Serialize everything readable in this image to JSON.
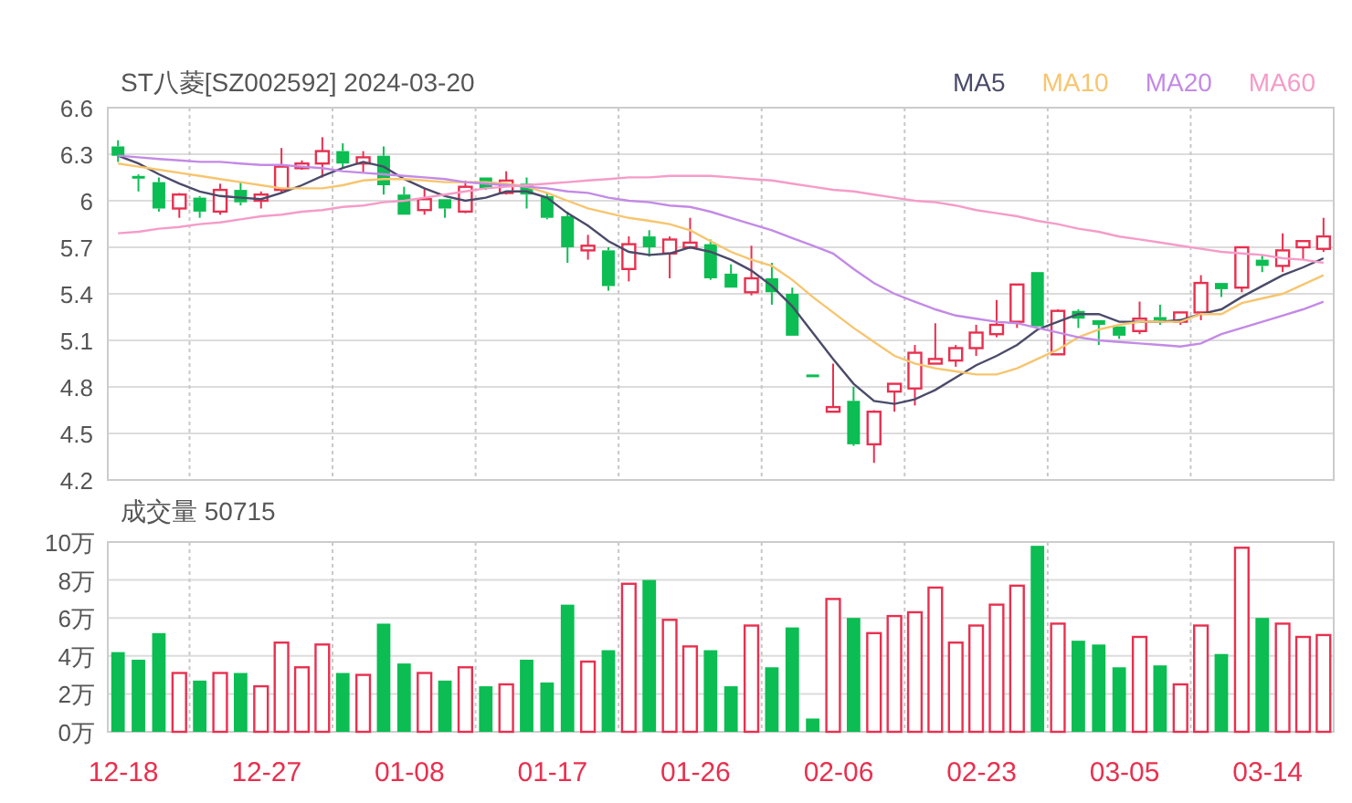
{
  "price_chart": {
    "title": "ST八菱[SZ002592] 2024-03-20",
    "chart_data": {
      "type": "candlestick",
      "grid": true,
      "ylim": [
        4.2,
        6.6
      ],
      "yticks": [
        4.2,
        4.5,
        4.8,
        5.1,
        5.4,
        5.7,
        6,
        6.3,
        6.6
      ],
      "ohlc": [
        [
          6.35,
          6.39,
          6.25,
          6.29
        ],
        [
          6.16,
          6.17,
          6.06,
          6.15
        ],
        [
          6.12,
          6.15,
          5.93,
          5.95
        ],
        [
          5.95,
          6.05,
          5.89,
          6.04
        ],
        [
          6.02,
          6.03,
          5.89,
          5.93
        ],
        [
          5.93,
          6.11,
          5.91,
          6.07
        ],
        [
          6.07,
          6.12,
          5.97,
          5.99
        ],
        [
          6.0,
          6.06,
          5.95,
          6.04
        ],
        [
          6.07,
          6.34,
          6.05,
          6.22
        ],
        [
          6.21,
          6.26,
          6.2,
          6.24
        ],
        [
          6.24,
          6.41,
          6.15,
          6.32
        ],
        [
          6.32,
          6.37,
          6.21,
          6.24
        ],
        [
          6.24,
          6.32,
          6.18,
          6.28
        ],
        [
          6.29,
          6.35,
          6.04,
          6.1
        ],
        [
          6.04,
          6.09,
          5.91,
          5.91
        ],
        [
          5.94,
          6.08,
          5.91,
          6.01
        ],
        [
          6.01,
          6.01,
          5.89,
          5.95
        ],
        [
          5.93,
          6.13,
          5.92,
          6.09
        ],
        [
          6.15,
          6.15,
          6.07,
          6.08
        ],
        [
          6.05,
          6.19,
          6.04,
          6.13
        ],
        [
          6.11,
          6.15,
          5.95,
          6.04
        ],
        [
          6.03,
          6.05,
          5.88,
          5.89
        ],
        [
          5.9,
          5.93,
          5.6,
          5.7
        ],
        [
          5.68,
          5.78,
          5.62,
          5.71
        ],
        [
          5.68,
          5.7,
          5.42,
          5.45
        ],
        [
          5.56,
          5.77,
          5.48,
          5.72
        ],
        [
          5.77,
          5.81,
          5.64,
          5.7
        ],
        [
          5.66,
          5.77,
          5.5,
          5.75
        ],
        [
          5.7,
          5.89,
          5.69,
          5.73
        ],
        [
          5.72,
          5.75,
          5.49,
          5.5
        ],
        [
          5.53,
          5.59,
          5.44,
          5.44
        ],
        [
          5.41,
          5.71,
          5.39,
          5.5
        ],
        [
          5.5,
          5.6,
          5.33,
          5.41
        ],
        [
          5.4,
          5.44,
          5.13,
          5.13
        ],
        [
          4.88,
          4.88,
          4.87,
          4.87
        ],
        [
          4.64,
          4.95,
          4.64,
          4.67
        ],
        [
          4.71,
          4.8,
          4.42,
          4.43
        ],
        [
          4.43,
          4.65,
          4.31,
          4.64
        ],
        [
          4.77,
          4.82,
          4.64,
          4.82
        ],
        [
          4.79,
          5.07,
          4.68,
          5.02
        ],
        [
          4.95,
          5.21,
          4.95,
          4.98
        ],
        [
          4.97,
          5.07,
          4.93,
          5.05
        ],
        [
          5.05,
          5.2,
          5.0,
          5.15
        ],
        [
          5.14,
          5.36,
          5.12,
          5.2
        ],
        [
          5.22,
          5.46,
          5.18,
          5.46
        ],
        [
          5.54,
          5.54,
          5.19,
          5.19
        ],
        [
          5.01,
          5.3,
          5.01,
          5.29
        ],
        [
          5.29,
          5.3,
          5.18,
          5.24
        ],
        [
          5.23,
          5.23,
          5.07,
          5.2
        ],
        [
          5.19,
          5.19,
          5.11,
          5.13
        ],
        [
          5.16,
          5.35,
          5.14,
          5.24
        ],
        [
          5.25,
          5.33,
          5.2,
          5.23
        ],
        [
          5.22,
          5.28,
          5.2,
          5.28
        ],
        [
          5.28,
          5.52,
          5.23,
          5.47
        ],
        [
          5.47,
          5.47,
          5.38,
          5.43
        ],
        [
          5.44,
          5.7,
          5.41,
          5.7
        ],
        [
          5.62,
          5.65,
          5.54,
          5.58
        ],
        [
          5.58,
          5.79,
          5.54,
          5.68
        ],
        [
          5.7,
          5.74,
          5.62,
          5.74
        ],
        [
          5.69,
          5.89,
          5.67,
          5.77
        ]
      ]
    }
  },
  "moving_averages": {
    "chart_data": {
      "type": "line",
      "ylim": [
        4.2,
        6.6
      ],
      "series": [
        {
          "name": "MA5",
          "color": "#4a4a6a",
          "values": [
            6.29,
            6.24,
            6.17,
            6.11,
            6.06,
            6.03,
            6.02,
            6.01,
            6.05,
            6.1,
            6.16,
            6.21,
            6.25,
            6.22,
            6.14,
            6.08,
            6.03,
            6.0,
            6.02,
            6.06,
            6.06,
            6.02,
            5.92,
            5.84,
            5.74,
            5.67,
            5.65,
            5.66,
            5.7,
            5.67,
            5.62,
            5.55,
            5.45,
            5.32,
            5.15,
            4.98,
            4.82,
            4.71,
            4.69,
            4.72,
            4.78,
            4.86,
            4.94,
            5.0,
            5.07,
            5.17,
            5.22,
            5.27,
            5.27,
            5.22,
            5.22,
            5.22,
            5.23,
            5.27,
            5.3,
            5.38,
            5.45,
            5.52,
            5.57,
            5.63
          ]
        },
        {
          "name": "MA10",
          "color": "#f7c56e",
          "values": [
            6.24,
            6.22,
            6.2,
            6.18,
            6.16,
            6.14,
            6.12,
            6.1,
            6.08,
            6.08,
            6.08,
            6.1,
            6.13,
            6.14,
            6.14,
            6.13,
            6.12,
            6.12,
            6.12,
            6.11,
            6.09,
            6.05,
            6.0,
            5.95,
            5.92,
            5.89,
            5.87,
            5.85,
            5.81,
            5.74,
            5.67,
            5.62,
            5.58,
            5.49,
            5.38,
            5.28,
            5.18,
            5.09,
            5.0,
            4.95,
            4.92,
            4.9,
            4.88,
            4.88,
            4.92,
            4.98,
            5.04,
            5.12,
            5.17,
            5.2,
            5.22,
            5.22,
            5.22,
            5.27,
            5.27,
            5.34,
            5.37,
            5.4,
            5.46,
            5.52
          ]
        },
        {
          "name": "MA20",
          "color": "#c38ae6",
          "values": [
            6.29,
            6.28,
            6.27,
            6.26,
            6.25,
            6.25,
            6.24,
            6.23,
            6.23,
            6.22,
            6.21,
            6.19,
            6.18,
            6.17,
            6.16,
            6.15,
            6.14,
            6.12,
            6.11,
            6.1,
            6.09,
            6.08,
            6.06,
            6.05,
            6.02,
            6.0,
            5.99,
            5.97,
            5.96,
            5.93,
            5.89,
            5.85,
            5.81,
            5.76,
            5.71,
            5.66,
            5.56,
            5.47,
            5.4,
            5.35,
            5.3,
            5.26,
            5.24,
            5.22,
            5.21,
            5.18,
            5.15,
            5.12,
            5.1,
            5.09,
            5.08,
            5.07,
            5.06,
            5.08,
            5.14,
            5.18,
            5.22,
            5.26,
            5.3,
            5.35
          ]
        },
        {
          "name": "MA60",
          "color": "#f59cc8",
          "values": [
            5.79,
            5.8,
            5.82,
            5.83,
            5.85,
            5.86,
            5.88,
            5.9,
            5.91,
            5.93,
            5.94,
            5.96,
            5.97,
            5.99,
            6.0,
            6.02,
            6.04,
            6.06,
            6.08,
            6.09,
            6.1,
            6.11,
            6.12,
            6.13,
            6.14,
            6.15,
            6.15,
            6.16,
            6.16,
            6.16,
            6.15,
            6.14,
            6.13,
            6.11,
            6.09,
            6.07,
            6.06,
            6.04,
            6.02,
            6.0,
            5.99,
            5.97,
            5.94,
            5.92,
            5.9,
            5.87,
            5.85,
            5.82,
            5.8,
            5.77,
            5.75,
            5.73,
            5.71,
            5.69,
            5.67,
            5.66,
            5.65,
            5.63,
            5.62,
            5.6
          ]
        }
      ]
    }
  },
  "volume_chart": {
    "title": "成交量 50715",
    "chart_data": {
      "type": "bar",
      "grid": true,
      "ylim": [
        0,
        10
      ],
      "yticks": [
        {
          "value": 0,
          "label": "0万"
        },
        {
          "value": 2,
          "label": "2万"
        },
        {
          "value": 4,
          "label": "4万"
        },
        {
          "value": 6,
          "label": "6万"
        },
        {
          "value": 8,
          "label": "8万"
        },
        {
          "value": 10,
          "label": "10万"
        }
      ],
      "categories": [
        "12-18",
        null,
        null,
        null,
        null,
        null,
        null,
        "12-27",
        null,
        null,
        null,
        null,
        null,
        null,
        "01-08",
        null,
        null,
        null,
        null,
        null,
        null,
        "01-17",
        null,
        null,
        null,
        null,
        null,
        null,
        "01-26",
        null,
        null,
        null,
        null,
        null,
        null,
        "02-06",
        null,
        null,
        null,
        null,
        null,
        null,
        "02-23",
        null,
        null,
        null,
        null,
        null,
        null,
        "03-05",
        null,
        null,
        null,
        null,
        null,
        null,
        "03-14",
        null,
        null,
        null
      ],
      "values": [
        4.2,
        3.8,
        5.2,
        3.1,
        2.7,
        3.1,
        3.1,
        2.4,
        4.7,
        3.4,
        4.6,
        3.1,
        3.0,
        5.7,
        3.6,
        3.1,
        2.7,
        3.4,
        2.4,
        2.5,
        3.8,
        2.6,
        6.7,
        3.7,
        4.3,
        7.8,
        8.0,
        5.9,
        4.5,
        4.3,
        2.4,
        5.6,
        3.4,
        5.5,
        0.7,
        7.0,
        6.0,
        5.2,
        6.1,
        6.3,
        7.6,
        4.7,
        5.6,
        6.7,
        7.7,
        9.8,
        5.7,
        4.8,
        4.6,
        3.4,
        5.0,
        3.5,
        2.5,
        5.6,
        4.1,
        9.7,
        6.0,
        5.7,
        5.0,
        5.1
      ]
    }
  }
}
